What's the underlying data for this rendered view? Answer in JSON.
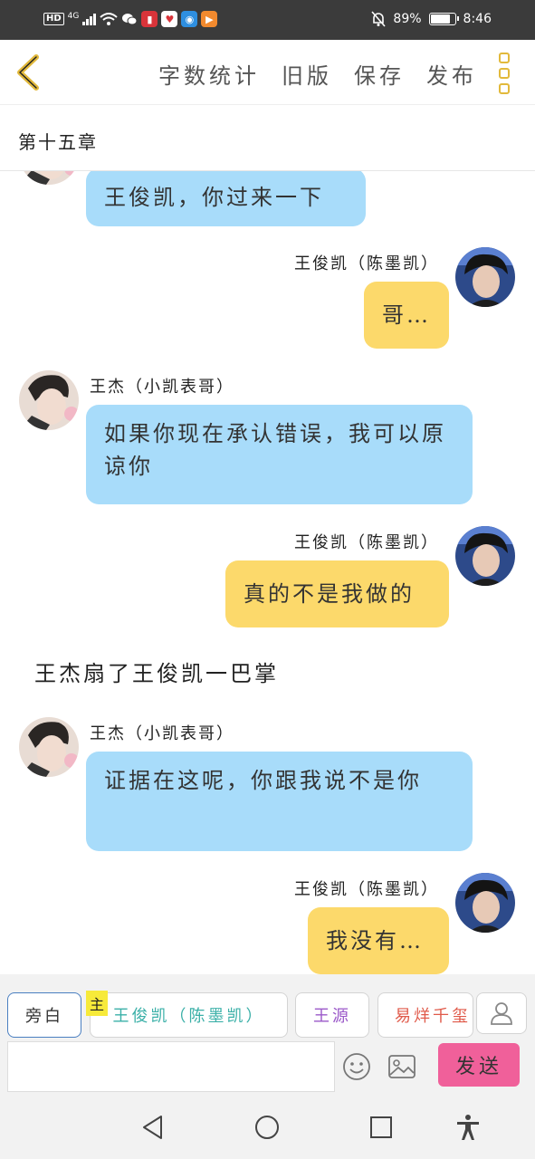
{
  "status_bar": {
    "hd": "HD",
    "network": "4G",
    "battery": "89%",
    "battery_level": 0.89,
    "time": "8:46"
  },
  "toolbar": {
    "word_count": "字数统计",
    "old_version": "旧版",
    "save": "保存",
    "publish": "发布"
  },
  "chapter_title": "第十五章",
  "messages": [
    {
      "side": "left",
      "speaker": "",
      "text": "王俊凯，你过来一下"
    },
    {
      "side": "right",
      "speaker": "王俊凯（陈墨凯）",
      "text": "哥…"
    },
    {
      "side": "left",
      "speaker": "王杰（小凯表哥）",
      "text": "如果你现在承认错误，我可以原谅你"
    },
    {
      "side": "right",
      "speaker": "王俊凯（陈墨凯）",
      "text": "真的不是我做的"
    },
    {
      "side": "narration",
      "text": "王杰扇了王俊凯一巴掌"
    },
    {
      "side": "left",
      "speaker": "王杰（小凯表哥）",
      "text": "证据在这呢，你跟我说不是你"
    },
    {
      "side": "right",
      "speaker": "王俊凯（陈墨凯）",
      "text": "我没有…"
    }
  ],
  "roles": {
    "narrator": "旁白",
    "main_tag": "主",
    "role1": "王俊凯（陈墨凯）",
    "role2": "王源",
    "role3": "易烊千玺"
  },
  "input": {
    "value": "",
    "placeholder": ""
  },
  "send_label": "发送",
  "colors": {
    "left_bubble": "#a8dcfa",
    "right_bubble": "#fcd96b",
    "send_button": "#f0609a",
    "accent_yellow": "#e2b93b",
    "role1_text": "#3bb0a8",
    "role2_text": "#9b59c9",
    "role3_text": "#e05a4a"
  }
}
